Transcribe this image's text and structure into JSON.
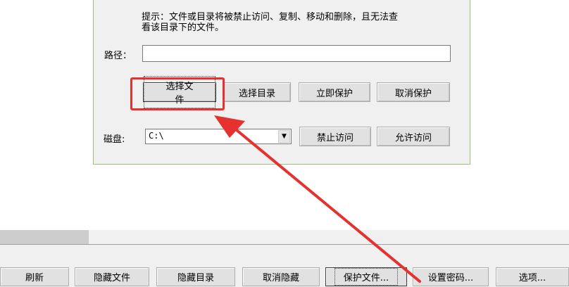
{
  "dialog": {
    "tip_line1": "提示：文件或目录将被禁止访问、复制、移动和删除，且无法查",
    "tip_line2": "看该目录下的文件。",
    "path_label": "路径：",
    "path_value": "",
    "buttons": {
      "select_file": "选择文件",
      "select_dir": "选择目录",
      "protect_now": "立即保护",
      "cancel_protect": "取消保护",
      "forbid_access": "禁止访问",
      "allow_access": "允许访问"
    },
    "disk_label": "磁盘:",
    "disk_value": "C:\\"
  },
  "toolbar": {
    "refresh": "刷新",
    "hide_file": "隐藏文件",
    "hide_dir": "隐藏目录",
    "unhide": "取消隐藏",
    "protect_file": "保护文件...",
    "set_password": "设置密码...",
    "options": "选项..."
  },
  "colors": {
    "highlight": "#e5312f",
    "arrow": "#e5312f",
    "dialog_border": "#9fbe7c"
  }
}
